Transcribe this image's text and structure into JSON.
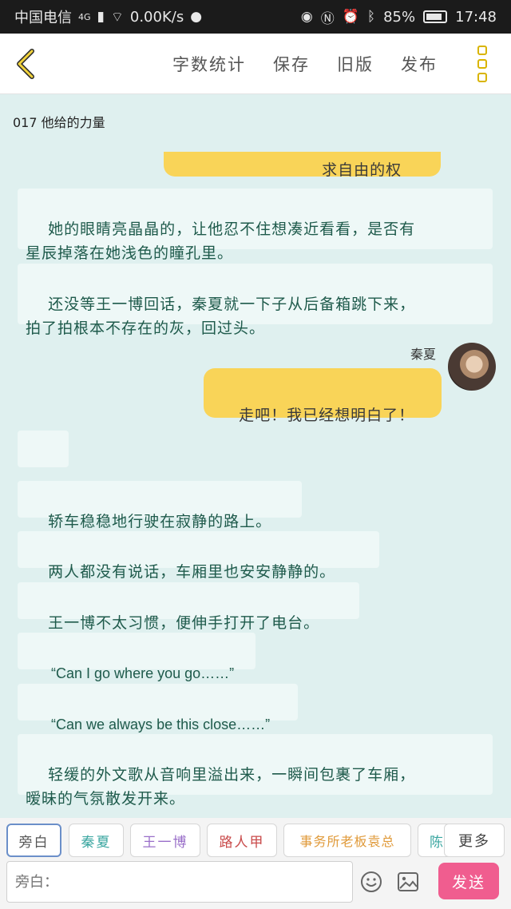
{
  "status_bar": {
    "carrier": "中国电信",
    "network": "4G",
    "speed": "0.00K/s",
    "battery": "85%",
    "battery_level": 0.85,
    "time": "17:48"
  },
  "toolbar": {
    "word_count": "字数统计",
    "save": "保存",
    "old_version": "旧版",
    "publish": "发布"
  },
  "chapter_title": "017 他给的力量",
  "messages": [
    {
      "text": "求自由的权利。"
    },
    {
      "text": "她的眼睛亮晶晶的，让他忍不住想凑近看看，是否有\n星辰掉落在她浅色的瞳孔里。"
    },
    {
      "text": "还没等王一博回话，秦夏就一下子从后备箱跳下来，\n拍了拍根本不存在的灰，回过头。"
    },
    {
      "speaker": "秦夏",
      "text": "走吧！我已经想明白了！"
    },
    {
      "text": "……"
    },
    {
      "text": "轿车稳稳地行驶在寂静的路上。"
    },
    {
      "text": "两人都没有说话，车厢里也安安静静的。"
    },
    {
      "text": "王一博不太习惯，便伸手打开了电台。"
    },
    {
      "text": "“Can I go where you go……”"
    },
    {
      "text": "“Can we always be this close……”"
    },
    {
      "text": "轻缓的外文歌从音响里溢出来，一瞬间包裹了车厢，\n暧昧的气氛散发开来。"
    }
  ],
  "roles": [
    {
      "label": "旁白",
      "color": "#555555"
    },
    {
      "label": "秦夏",
      "color": "#3aa6a0"
    },
    {
      "label": "王一博",
      "color": "#9a6fc9"
    },
    {
      "label": "路人甲",
      "color": "#c94b4b"
    },
    {
      "label": "事务所老板袁总",
      "color": "#e09a3a"
    },
    {
      "label": "陈",
      "color": "#3aa6a0"
    }
  ],
  "more_label": "更多",
  "input": {
    "placeholder": "旁白："
  },
  "send_label": "发送",
  "colors": {
    "accent_yellow": "#f9d458",
    "send_pink": "#f05d8f",
    "background": "#dff0ef"
  }
}
